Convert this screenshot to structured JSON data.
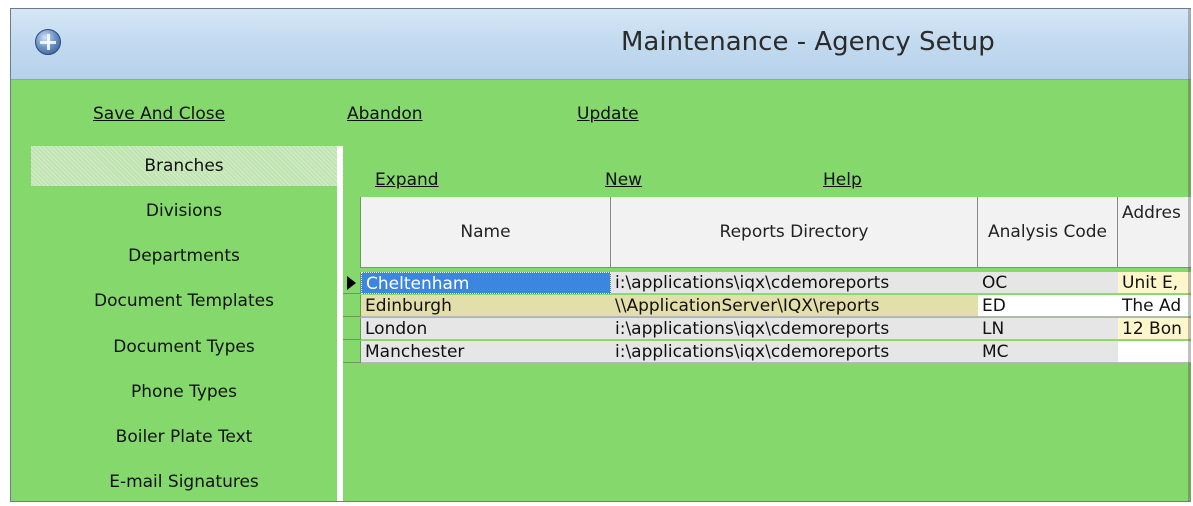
{
  "window": {
    "title": "Maintenance - Agency Setup",
    "icon": "globe-app-icon"
  },
  "toolbar": {
    "save_close_label": "Save And Close",
    "abandon_label": "Abandon",
    "update_label": "Update"
  },
  "sidebar": {
    "items": [
      {
        "label": "Branches",
        "selected": true
      },
      {
        "label": "Divisions"
      },
      {
        "label": "Departments"
      },
      {
        "label": "Document Templates"
      },
      {
        "label": "Document Types"
      },
      {
        "label": "Phone Types"
      },
      {
        "label": "Boiler Plate Text"
      },
      {
        "label": "E-mail Signatures"
      }
    ]
  },
  "subtoolbar": {
    "expand_label": "Expand",
    "new_label": "New",
    "help_label": "Help"
  },
  "grid": {
    "columns": [
      "Name",
      "Reports Directory",
      "Analysis Code",
      "Addres"
    ],
    "rows": [
      {
        "current": true,
        "cells": [
          "Cheltenham",
          "i:\\applications\\iqx\\cdemoreports",
          "OC",
          "Unit E,"
        ]
      },
      {
        "cells": [
          "Edinburgh",
          "\\\\ApplicationServer\\IQX\\reports",
          "ED",
          "The Ad"
        ]
      },
      {
        "cells": [
          "London",
          "i:\\applications\\iqx\\cdemoreports",
          "LN",
          "12 Bon"
        ]
      },
      {
        "cells": [
          "Manchester",
          "i:\\applications\\iqx\\cdemoreports",
          "MC",
          ""
        ]
      }
    ]
  },
  "colors": {
    "panel_green": "#84d86c",
    "selection_blue": "#3d86e0",
    "edit_yellow": "#e3dfaa",
    "address_yellow": "#fff6cc"
  }
}
